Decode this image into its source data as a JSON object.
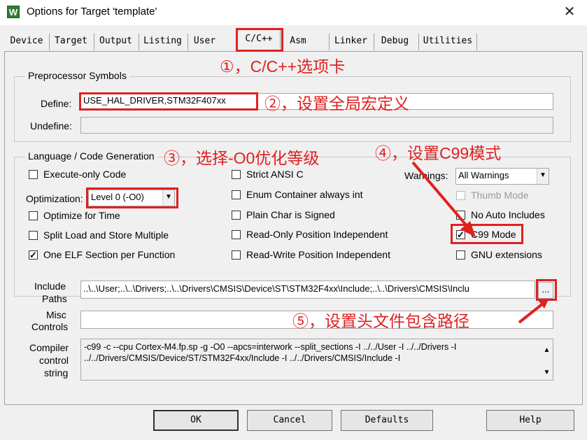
{
  "window": {
    "app_icon": "W",
    "title": "Options for Target 'template'",
    "close_glyph": "✕"
  },
  "tabs": [
    {
      "label": "Device",
      "active": false
    },
    {
      "label": "Target",
      "active": false
    },
    {
      "label": "Output",
      "active": false
    },
    {
      "label": "Listing",
      "active": false
    },
    {
      "label": "User",
      "active": false
    },
    {
      "label": "C/C++",
      "active": true
    },
    {
      "label": "Asm",
      "active": false
    },
    {
      "label": "Linker",
      "active": false
    },
    {
      "label": "Debug",
      "active": false
    },
    {
      "label": "Utilities",
      "active": false
    }
  ],
  "preprocessor": {
    "group_title": "Preprocessor Symbols",
    "define_label": "Define:",
    "define_value": "USE_HAL_DRIVER,STM32F407xx",
    "undefine_label": "Undefine:",
    "undefine_value": ""
  },
  "language": {
    "group_title": "Language / Code Generation",
    "execute_only": {
      "label": "Execute-only Code",
      "checked": false
    },
    "optimization_label": "Optimization:",
    "optimization_value": "Level 0 (-O0)",
    "optimize_time": {
      "label": "Optimize for Time",
      "checked": false
    },
    "split_load": {
      "label": "Split Load and Store Multiple",
      "checked": false
    },
    "one_elf": {
      "label": "One ELF Section per Function",
      "checked": true
    },
    "strict_ansi": {
      "label": "Strict ANSI C",
      "checked": false
    },
    "enum_container": {
      "label": "Enum Container always int",
      "checked": false
    },
    "plain_char": {
      "label": "Plain Char is Signed",
      "checked": false
    },
    "ro_pi": {
      "label": "Read-Only Position Independent",
      "checked": false
    },
    "rw_pi": {
      "label": "Read-Write Position Independent",
      "checked": false
    },
    "warnings_label": "Warnings:",
    "warnings_value": "All Warnings",
    "thumb_mode": {
      "label": "Thumb Mode",
      "checked": false,
      "disabled": true
    },
    "no_auto_includes": {
      "label": "No Auto Includes",
      "checked": false
    },
    "c99_mode": {
      "label": "C99 Mode",
      "checked": true
    },
    "gnu_ext": {
      "label": "GNU extensions",
      "checked": false
    }
  },
  "paths": {
    "include_label_1": "Include",
    "include_label_2": "Paths",
    "include_value": "..\\..\\User;..\\..\\Drivers;..\\..\\Drivers\\CMSIS\\Device\\ST\\STM32F4xx\\Include;..\\..\\Drivers\\CMSIS\\Inclu",
    "browse_label": "...",
    "misc_label_1": "Misc",
    "misc_label_2": "Controls",
    "misc_value": "",
    "compiler_label_1": "Compiler",
    "compiler_label_2": "control",
    "compiler_label_3": "string",
    "compiler_line_1": "-c99 -c --cpu Cortex-M4.fp.sp -g -O0 --apcs=interwork --split_sections -I ../../User -I ../../Drivers -I",
    "compiler_line_2": "../../Drivers/CMSIS/Device/ST/STM32F4xx/Include -I ../../Drivers/CMSIS/Include -I"
  },
  "annotations": {
    "a1": "①，C/C++选项卡",
    "a2": "②，设置全局宏定义",
    "a3": "③，选择-O0优化等级",
    "a4": "④，设置C99模式",
    "a5": "⑤，设置头文件包含路径"
  },
  "buttons": {
    "ok": "OK",
    "cancel": "Cancel",
    "defaults": "Defaults",
    "help": "Help"
  },
  "colors": {
    "annotation": "#e02020",
    "checked_mark": "#000000"
  }
}
